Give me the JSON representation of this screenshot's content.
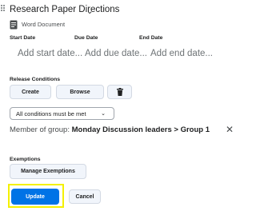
{
  "header": {
    "title": "Research Paper Directions",
    "doc_type": "Word Document"
  },
  "dates": [
    {
      "label": "Start Date",
      "placeholder": "Add start date..."
    },
    {
      "label": "Due Date",
      "placeholder": "Add due date..."
    },
    {
      "label": "End Date",
      "placeholder": "Add end date..."
    }
  ],
  "release": {
    "label": "Release Conditions",
    "create_label": "Create",
    "browse_label": "Browse",
    "condition_select": "All conditions must be met",
    "member_prefix": "Member of group:",
    "member_group": "Monday Discussion leaders > Group 1"
  },
  "exemptions": {
    "label": "Exemptions",
    "manage_label": "Manage Exemptions"
  },
  "footer": {
    "update_label": "Update",
    "cancel_label": "Cancel"
  },
  "colors": {
    "primary": "#0073e6",
    "highlight": "#f4f000",
    "secondary_button": "#f1f5fb"
  }
}
